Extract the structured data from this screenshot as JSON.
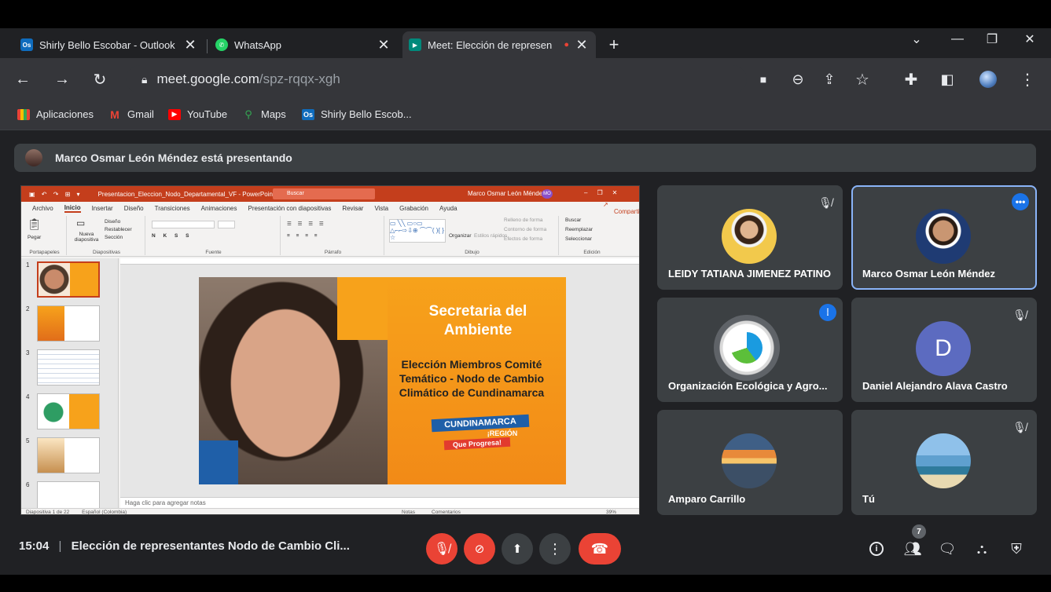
{
  "browser": {
    "tabs": [
      {
        "title": "Shirly Bello Escobar - Outlook",
        "favicon": "outlook-icon"
      },
      {
        "title": "WhatsApp",
        "favicon": "whatsapp-icon"
      },
      {
        "title": "Meet: Elección de represen",
        "favicon": "meet-icon",
        "active": true
      }
    ],
    "new_tab_label": "+",
    "url_host": "meet.google.com",
    "url_path": "/spz-rqqx-xgh",
    "bookmarks": [
      {
        "label": "Aplicaciones",
        "icon": "apps-grid-icon"
      },
      {
        "label": "Gmail",
        "icon": "gmail-icon"
      },
      {
        "label": "YouTube",
        "icon": "youtube-icon"
      },
      {
        "label": "Maps",
        "icon": "maps-icon"
      },
      {
        "label": "Shirly Bello Escob...",
        "icon": "outlook-icon"
      }
    ]
  },
  "meet": {
    "presenting_text": "Marco Osmar León Méndez está presentando",
    "time": "15:04",
    "meeting_title": "Elección de representantes Nodo de Cambio Cli...",
    "participant_count": "7",
    "participants": [
      {
        "name": "LEIDY TATIANA JIMENEZ PATINO",
        "muted": true
      },
      {
        "name": "Marco Osmar León Méndez",
        "presenting": true
      },
      {
        "name": "Organización Ecológica y Agro...",
        "speaking": true
      },
      {
        "name": "Daniel Alejandro Alava Castro",
        "initial": "D",
        "muted": true
      },
      {
        "name": "Amparo Carrillo"
      },
      {
        "name": "Tú",
        "muted": true
      }
    ]
  },
  "ppt": {
    "window_title": "Presentacion_Eleccion_Nodo_Departamental_VF - PowerPoint",
    "search_placeholder": "Buscar",
    "user": "Marco Osmar León Méndez",
    "user_initials": "MO",
    "share_label": "Compartir",
    "menu": [
      "Archivo",
      "Inicio",
      "Insertar",
      "Diseño",
      "Transiciones",
      "Animaciones",
      "Presentación con diapositivas",
      "Revisar",
      "Vista",
      "Grabación",
      "Ayuda"
    ],
    "ribbon_groups": [
      "Portapapeles",
      "Diapositivas",
      "Fuente",
      "Párrafo",
      "Dibujo",
      "Edición"
    ],
    "ribbon_items": {
      "paste": "Pegar",
      "new_slide": "Nueva diapositiva",
      "layout": "Diseño",
      "reset": "Restablecer",
      "section": "Sección",
      "arrange": "Organizar",
      "quick_styles": "Estilos rápidos",
      "shape_fill": "Relleno de forma",
      "shape_outline": "Contorno de forma",
      "shape_effects": "Efectos de forma",
      "find": "Buscar",
      "replace": "Reemplazar",
      "select": "Seleccionar"
    },
    "slide_numbers": [
      "1",
      "2",
      "3",
      "4",
      "5",
      "6"
    ],
    "slide_title": "Secretaria del Ambiente",
    "slide_subtitle": "Elección Miembros Comité Temático - Nodo de Cambio Climático de Cundinamarca",
    "brand_line1": "CUNDINAMARCA",
    "brand_line2": "¡REGIÓN",
    "brand_line3": "Que Progresa!",
    "notes_placeholder": "Haga clic para agregar notas",
    "status_left": "Diapositiva 1 de 22",
    "status_lang": "Español (Colombia)",
    "status_notes": "Notas",
    "status_comments": "Comentarios",
    "zoom": "39%"
  },
  "colors": {
    "meet_bg": "#202124",
    "tile_bg": "#3c4043",
    "accent_blue": "#8ab4f8",
    "danger_red": "#ea4335",
    "ppt_orange": "#c43e1c"
  }
}
